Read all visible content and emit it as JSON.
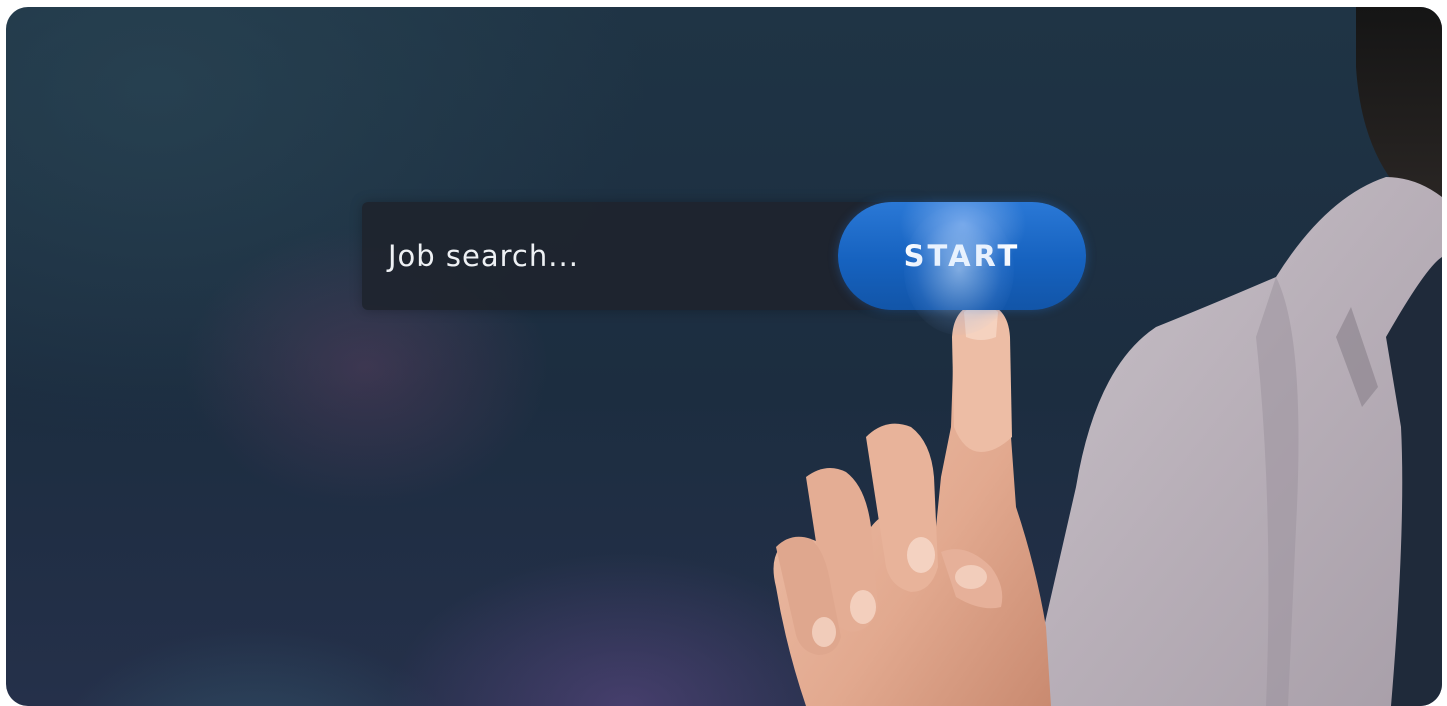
{
  "search": {
    "placeholder": "Job search...",
    "button_label": "START"
  },
  "colors": {
    "background": "#1f3445",
    "field": "#1e242e",
    "button": "#1662bf",
    "text": "#eef1f4"
  },
  "icons": [
    "hand-pointer",
    "person"
  ]
}
